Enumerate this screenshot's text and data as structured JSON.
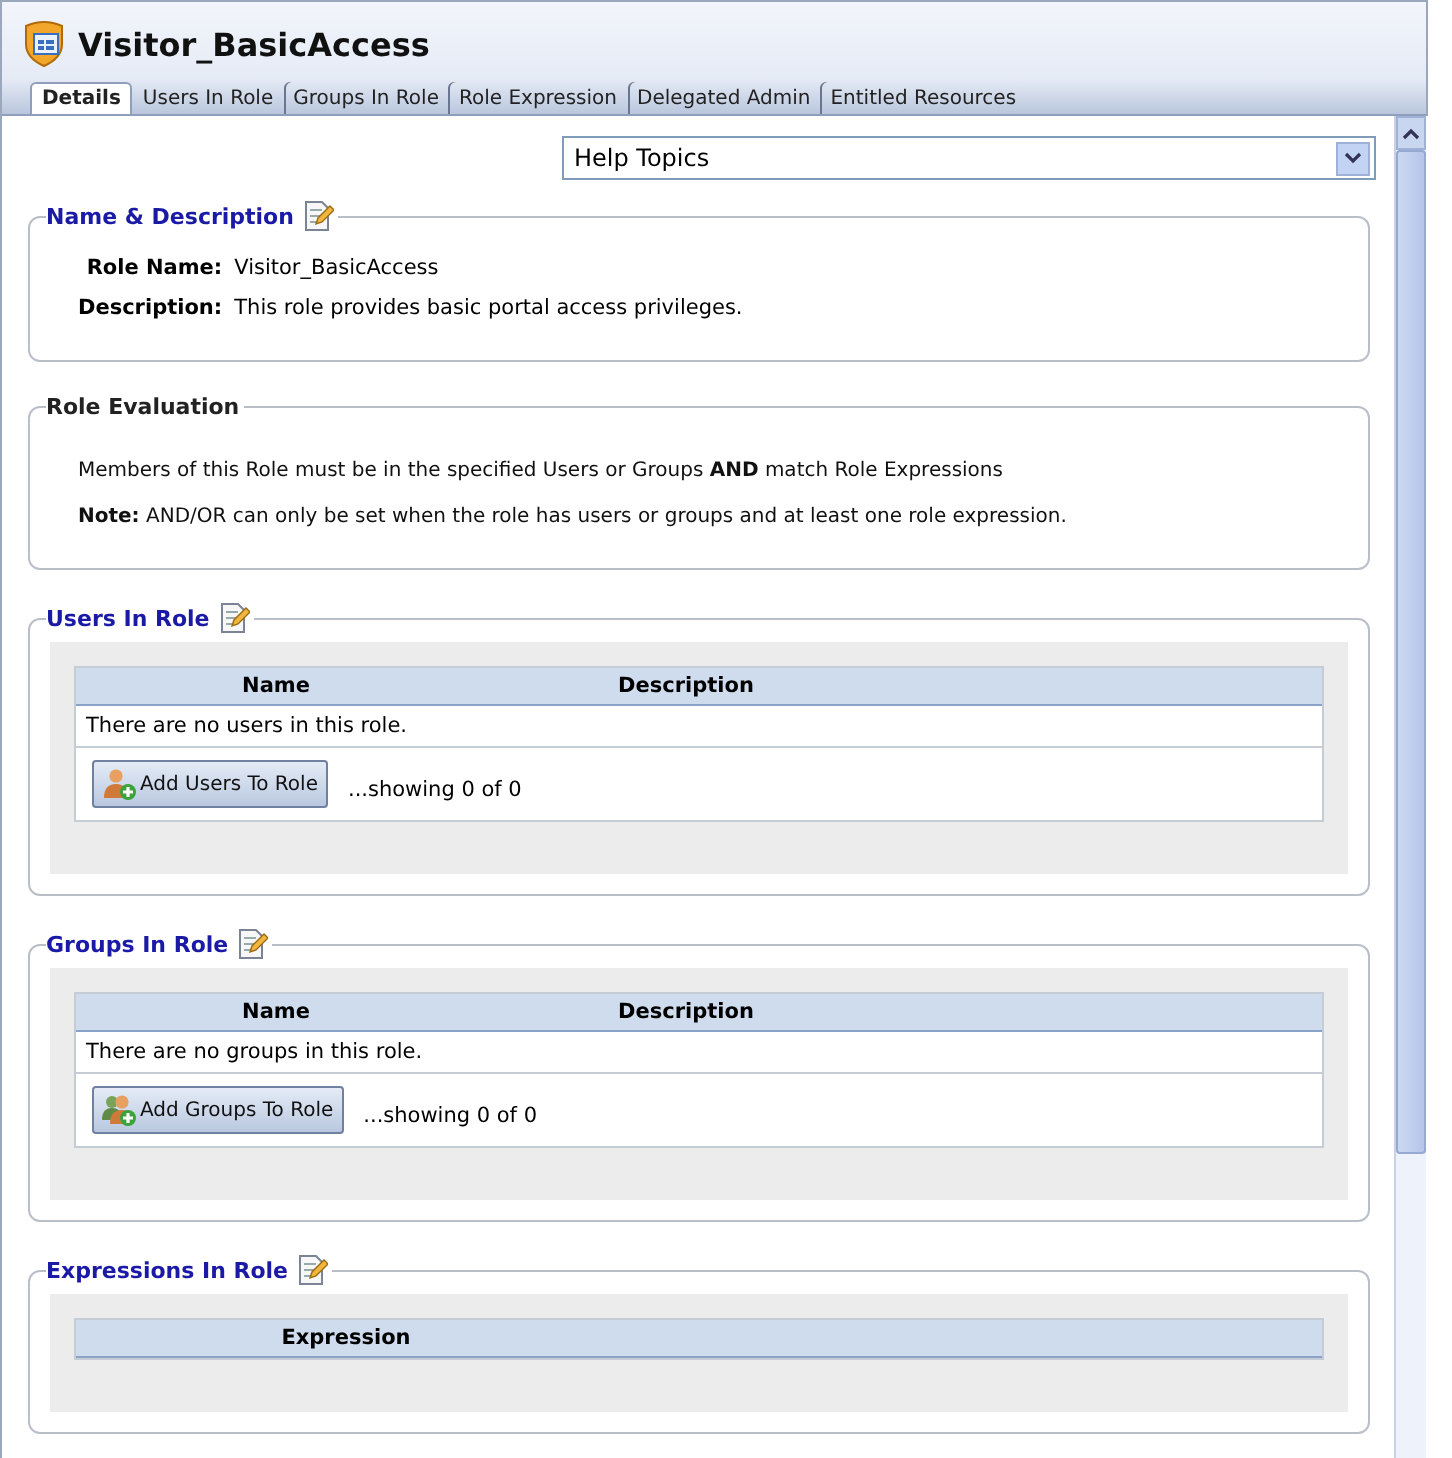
{
  "window": {
    "title": "Visitor_BasicAccess"
  },
  "tabs": [
    {
      "label": "Details",
      "selected": true
    },
    {
      "label": "Users In Role",
      "selected": false
    },
    {
      "label": "Groups In Role",
      "selected": false
    },
    {
      "label": "Role Expression",
      "selected": false
    },
    {
      "label": "Delegated Admin",
      "selected": false
    },
    {
      "label": "Entitled Resources",
      "selected": false
    }
  ],
  "help_select": {
    "value": "Help Topics"
  },
  "sections": [
    {
      "kind": "details",
      "title": "Name & Description",
      "editable": true,
      "fields": [
        {
          "label": "Role Name:",
          "value": "Visitor_BasicAccess"
        },
        {
          "label": "Description:",
          "value": "This role provides basic portal access privileges."
        }
      ]
    },
    {
      "kind": "text",
      "title": "Role Evaluation",
      "editable": false,
      "lines": [
        "Members of this Role must be in the specified Users or Groups **AND** match Role Expressions",
        "**Note:** AND/OR can only be set when the role has users or groups and at least one role expression."
      ]
    },
    {
      "kind": "table",
      "title": "Users In Role",
      "editable": true,
      "columns": [
        "Name",
        "Description"
      ],
      "empty_message": "There are no users in this role.",
      "button": {
        "label": "Add Users To Role",
        "kind": "user"
      },
      "count": "...showing 0 of 0"
    },
    {
      "kind": "table",
      "title": "Groups In Role",
      "editable": true,
      "columns": [
        "Name",
        "Description"
      ],
      "empty_message": "There are no groups in this role.",
      "button": {
        "label": "Add Groups To Role",
        "kind": "group"
      },
      "count": "...showing 0 of 0"
    },
    {
      "kind": "table",
      "title": "Expressions In Role",
      "editable": true,
      "columns": [
        "Expression"
      ]
    }
  ]
}
